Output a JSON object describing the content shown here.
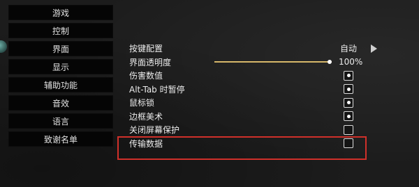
{
  "nav": {
    "items": [
      {
        "label": "游戏"
      },
      {
        "label": "控制"
      },
      {
        "label": "界面"
      },
      {
        "label": "显示"
      },
      {
        "label": "辅助功能"
      },
      {
        "label": "音效"
      },
      {
        "label": "语言"
      },
      {
        "label": "致谢名单"
      }
    ]
  },
  "settings": {
    "keybind": {
      "label": "按键配置",
      "value": "自动"
    },
    "ui_opacity": {
      "label": "界面透明度",
      "value": "100%",
      "level": 1.0
    },
    "damage_numbers": {
      "label": "伤害数值",
      "checked": true
    },
    "alt_tab_pause": {
      "label": "Alt-Tab 时暂停",
      "checked": true
    },
    "mouse_lock": {
      "label": "鼠标锁",
      "checked": true
    },
    "border_art": {
      "label": "边框美术",
      "checked": true
    },
    "screensaver_off": {
      "label": "关闭屏幕保护",
      "checked": false
    },
    "transmit_data": {
      "label": "传输数据",
      "checked": false
    }
  },
  "colors": {
    "background": "#1c1c1c",
    "nav_button": "#050505",
    "slider": "#d7b86a",
    "highlight": "#d0302a"
  },
  "icons": {
    "keybind_next": "arrow-right-icon"
  }
}
